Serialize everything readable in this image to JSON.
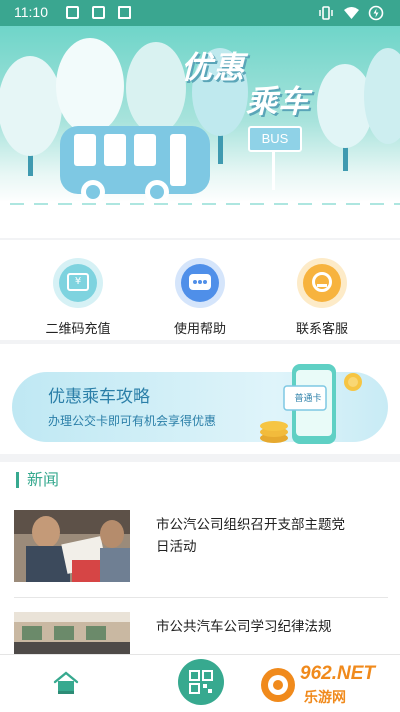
{
  "status_bar": {
    "time": "11:10"
  },
  "hero": {
    "title_line1": "优惠",
    "title_line2": "乘车",
    "bus_sign": "BUS"
  },
  "menu": {
    "items": [
      {
        "label": "二维码充值",
        "icon": "wallet-card-icon",
        "color": "#7ed3df"
      },
      {
        "label": "使用帮助",
        "icon": "chat-bubble-icon",
        "color": "#4f8fe9"
      },
      {
        "label": "联系客服",
        "icon": "headset-icon",
        "color": "#f7b33e"
      }
    ]
  },
  "banner": {
    "title": "优惠乘车攻略",
    "subtitle": "办理公交卡即可有机会享得优惠",
    "card_text": "普通卡"
  },
  "news": {
    "heading": "新闻",
    "items": [
      {
        "title": "市公汽公司组织召开支部主题党日活动"
      },
      {
        "title": "市公共汽车公司学习纪律法规"
      }
    ]
  },
  "watermark": {
    "line1": "962.NET",
    "line2": "乐游网"
  },
  "colors": {
    "accent": "#37a98f",
    "status_bar": "#3aa690",
    "banner_text": "#2b7fa8"
  }
}
